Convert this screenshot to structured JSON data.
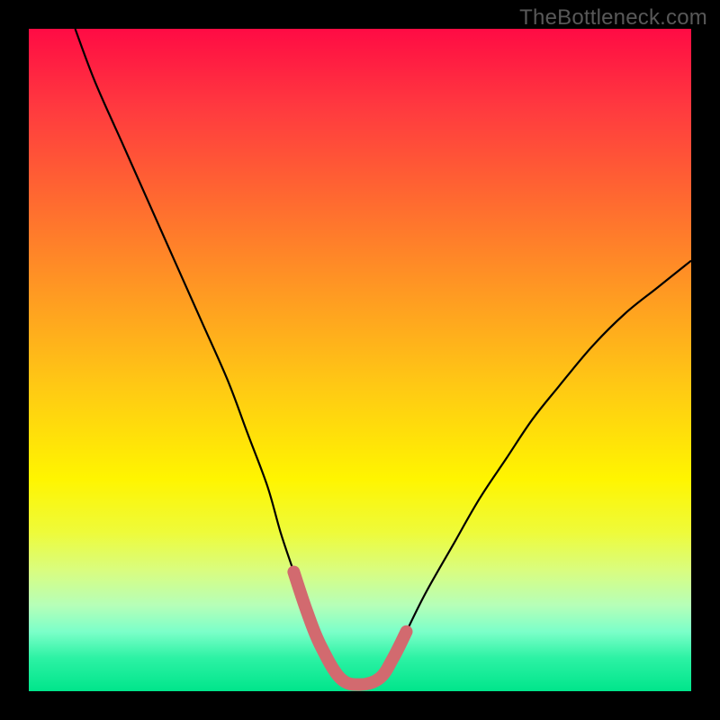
{
  "watermark": "TheBottleneck.com",
  "chart_data": {
    "type": "line",
    "title": "",
    "xlabel": "",
    "ylabel": "",
    "xlim": [
      0,
      100
    ],
    "ylim": [
      0,
      100
    ],
    "series": [
      {
        "name": "black-curve",
        "color": "#000000",
        "x": [
          7,
          10,
          14,
          18,
          22,
          26,
          30,
          33,
          36,
          38,
          40,
          42,
          44,
          47,
          50,
          53,
          55,
          57,
          60,
          64,
          68,
          72,
          76,
          80,
          85,
          90,
          95,
          100
        ],
        "values": [
          100,
          92,
          83,
          74,
          65,
          56,
          47,
          39,
          31,
          24,
          18,
          12,
          7,
          2,
          1,
          2,
          5,
          9,
          15,
          22,
          29,
          35,
          41,
          46,
          52,
          57,
          61,
          65
        ]
      },
      {
        "name": "thick-pink-segment",
        "color": "#d26a6f",
        "x": [
          40,
          42,
          44,
          47,
          50,
          53,
          55,
          57
        ],
        "values": [
          18,
          12,
          7,
          2,
          1,
          2,
          5,
          9
        ]
      }
    ],
    "annotations": []
  }
}
